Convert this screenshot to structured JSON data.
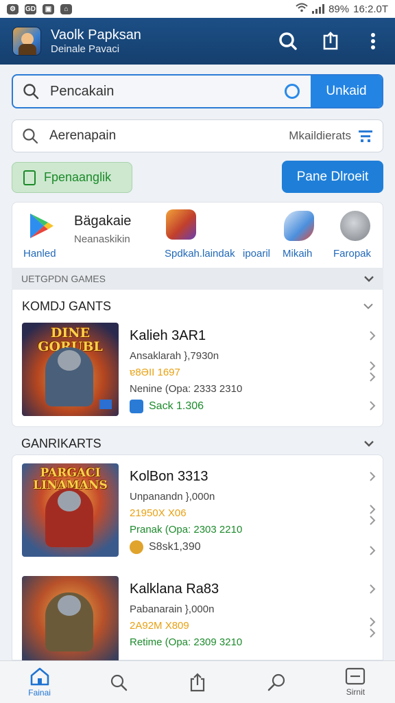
{
  "status_bar": {
    "battery": "89%",
    "time": "16:2.0T"
  },
  "app_bar": {
    "title": "Vaolk Papksan",
    "subtitle": "Deinale Pavaci"
  },
  "search_primary": {
    "placeholder": "Pencakain",
    "button_label": "Unkaid"
  },
  "search_secondary": {
    "placeholder": "Aerenapain",
    "right_label": "Mkaildierats"
  },
  "buttons": {
    "green_label": "Fpenaanglik",
    "blue_label": "Pane Dlroeit"
  },
  "apps_row": {
    "featured_name": "Bägakaie",
    "featured_sub": "Neanaskikin",
    "labels": [
      "Hanled",
      "Spdkah.laindak",
      "ipoaril",
      "Mikaih",
      "Faropak"
    ]
  },
  "upcoming_strip": "UETGPDN GAMES",
  "section1": {
    "heading": "KOMDJ GANTS",
    "games": [
      {
        "thumb_title": "DINE GORUBL",
        "title": "Kalieh 3AR1",
        "line1": "Ansaklarah },7930n",
        "line2": "ɐ8ƏII 1697",
        "line3": "Nenine (Opa: 2333 2310",
        "chip": "Sack 1.306"
      }
    ]
  },
  "section2": {
    "heading": "GANRIKARTS",
    "games": [
      {
        "thumb_title": "PARGACI LINAMANS",
        "title": "KolBon 3313",
        "line1": "Unpanandn },000n",
        "line2": "21950X X06",
        "line3": "Pranak (Opa: 2303 2210",
        "chip": "S8sk1,390"
      },
      {
        "thumb_title": "",
        "title": "Kalklana Ra83",
        "line1": "Pabanarain },000n",
        "line2": "2A92M X809",
        "line3": "Retime (Opa: 2309 3210",
        "chip": ""
      }
    ]
  },
  "bottom_nav": {
    "items": [
      {
        "label": "Fainai",
        "icon": "home-icon"
      },
      {
        "label": "",
        "icon": "search-icon"
      },
      {
        "label": "",
        "icon": "share-icon"
      },
      {
        "label": "",
        "icon": "chat-icon"
      },
      {
        "label": "Sirnit",
        "icon": "menu-icon"
      }
    ]
  },
  "colors": {
    "app_bar": "#1c4f86",
    "accent_blue": "#2384e3",
    "green": "#1d8a2c",
    "orange": "#e8a012"
  }
}
